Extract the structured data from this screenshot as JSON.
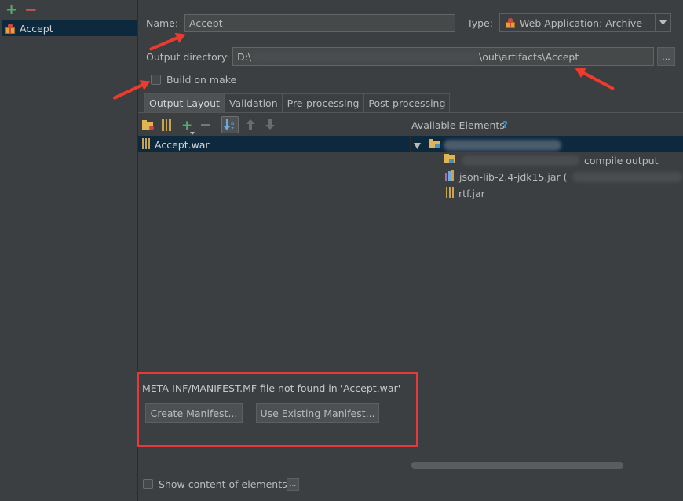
{
  "left_panel": {
    "add_symbol": "+",
    "remove_symbol": "−",
    "artifacts": [
      {
        "label": "Accept",
        "icon": "gift-icon"
      }
    ]
  },
  "form": {
    "name_label": "Name:",
    "name_value": "Accept",
    "type_label": "Type:",
    "type_value": "Web Application: Archive",
    "output_dir_label": "Output directory:",
    "output_dir_prefix": "D:\\",
    "output_dir_suffix": "\\out\\artifacts\\Accept",
    "browse_label": "...",
    "build_on_make_label": "Build on make",
    "build_on_make_checked": false
  },
  "tabs": [
    {
      "label": "Output Layout",
      "active": true
    },
    {
      "label": "Validation",
      "active": false
    },
    {
      "label": "Pre-processing",
      "active": false
    },
    {
      "label": "Post-processing",
      "active": false
    }
  ],
  "output_tree": [
    {
      "label": "Accept.war",
      "icon": "jar-icon"
    }
  ],
  "available": {
    "title": "Available Elements",
    "help": "?",
    "items": [
      {
        "label": "compile output",
        "icon": "module-output-icon"
      },
      {
        "label": "json-lib-2.4-jdk15.jar (",
        "icon": "library-icon"
      },
      {
        "label": "rtf.jar",
        "icon": "jar-icon"
      }
    ]
  },
  "manifest": {
    "message": "META-INF/MANIFEST.MF file not found in 'Accept.war'",
    "create_label": "Create Manifest...",
    "existing_label": "Use Existing Manifest..."
  },
  "footer": {
    "show_content_label": "Show content of elements",
    "more_label": "..."
  },
  "colors": {
    "accent_selection": "#0d293e",
    "annotation_red": "#ee3b2f"
  }
}
